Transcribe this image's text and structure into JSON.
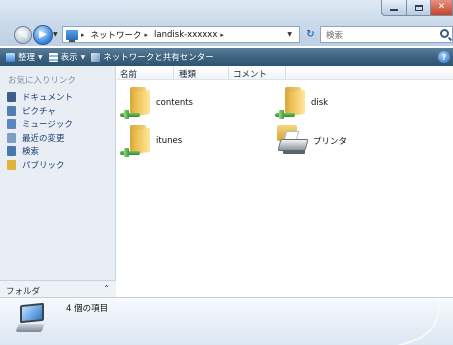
{
  "window": {
    "controls": {
      "minimize": "–",
      "maximize": "□",
      "close": "✕"
    }
  },
  "address": {
    "crumbs": [
      "ネットワーク",
      "landisk-xxxxxx"
    ],
    "separator": "▸"
  },
  "search": {
    "placeholder": "検索"
  },
  "toolbar": {
    "organize": "整理",
    "views": "表示",
    "network_center": "ネットワークと共有センター"
  },
  "sidebar": {
    "title": "お気に入りリンク",
    "items": [
      {
        "label": "ドキュメント",
        "icon": "documents-icon",
        "color": "#3b5f8a"
      },
      {
        "label": "ピクチャ",
        "icon": "pictures-icon",
        "color": "#4f7fb0"
      },
      {
        "label": "ミュージック",
        "icon": "music-icon",
        "color": "#5a86c4"
      },
      {
        "label": "最近の変更",
        "icon": "recent-changes-icon",
        "color": "#7f9fc0"
      },
      {
        "label": "検索",
        "icon": "search-folder-icon",
        "color": "#4a78ad"
      },
      {
        "label": "パブリック",
        "icon": "public-folder-icon",
        "color": "#e2b23f"
      }
    ],
    "folders_label": "フォルダ"
  },
  "columns": {
    "name": "名前",
    "type": "種類",
    "comment": "コメント"
  },
  "items": [
    {
      "label": "contents",
      "icon": "shared-folder-icon"
    },
    {
      "label": "disk",
      "icon": "shared-folder-icon"
    },
    {
      "label": "itunes",
      "icon": "shared-folder-icon"
    },
    {
      "label": "プリンタ",
      "icon": "printer-icon"
    }
  ],
  "details": {
    "count": "4 個の項目"
  },
  "colors": {
    "toolbar": "#3d6380",
    "sidebar_bg": "#e9eef5",
    "link": "#1c3b73",
    "close": "#c4432b"
  }
}
